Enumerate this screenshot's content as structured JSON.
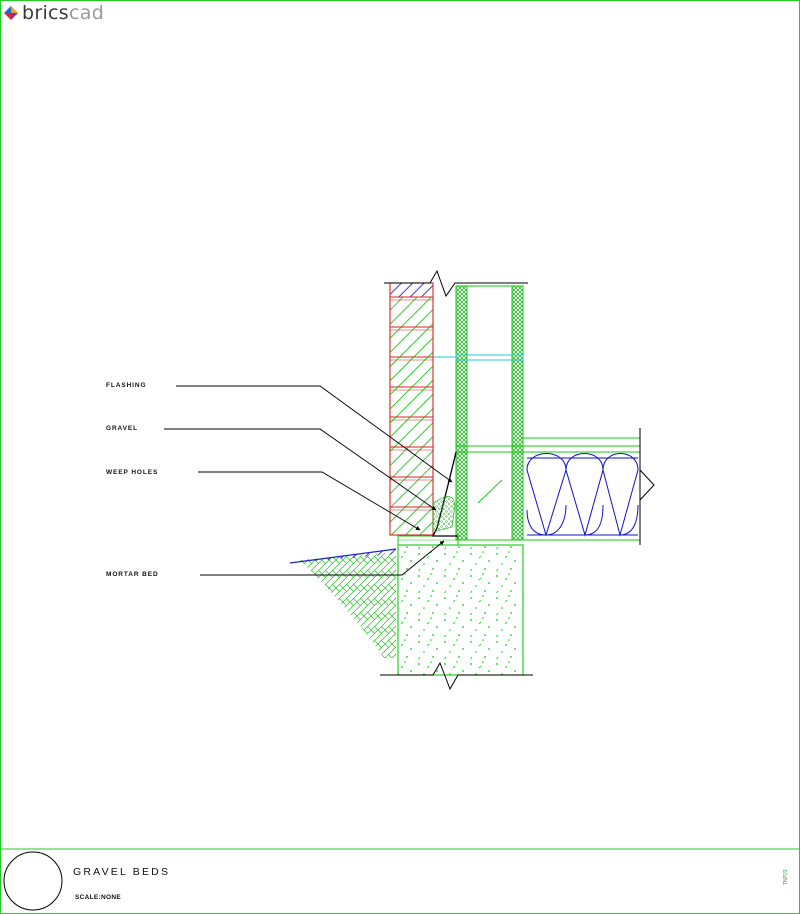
{
  "logo": {
    "prefix": "brics",
    "suffix": "cad"
  },
  "callouts": {
    "flashing": "FLASHING",
    "gravel": "GRAVEL",
    "weep_holes": "WEEP HOLES",
    "mortar_bed": "MORTAR BED"
  },
  "title_block": {
    "title": "GRAVEL BEDS",
    "scale": "SCALE:NONE",
    "code": "TNP23"
  },
  "colors": {
    "frame": "#22cc22",
    "brick": "#dd2222",
    "concrete": "#11cc11",
    "insulation": "#1111cc",
    "cyan": "#22cccc",
    "leader": "#000000"
  }
}
